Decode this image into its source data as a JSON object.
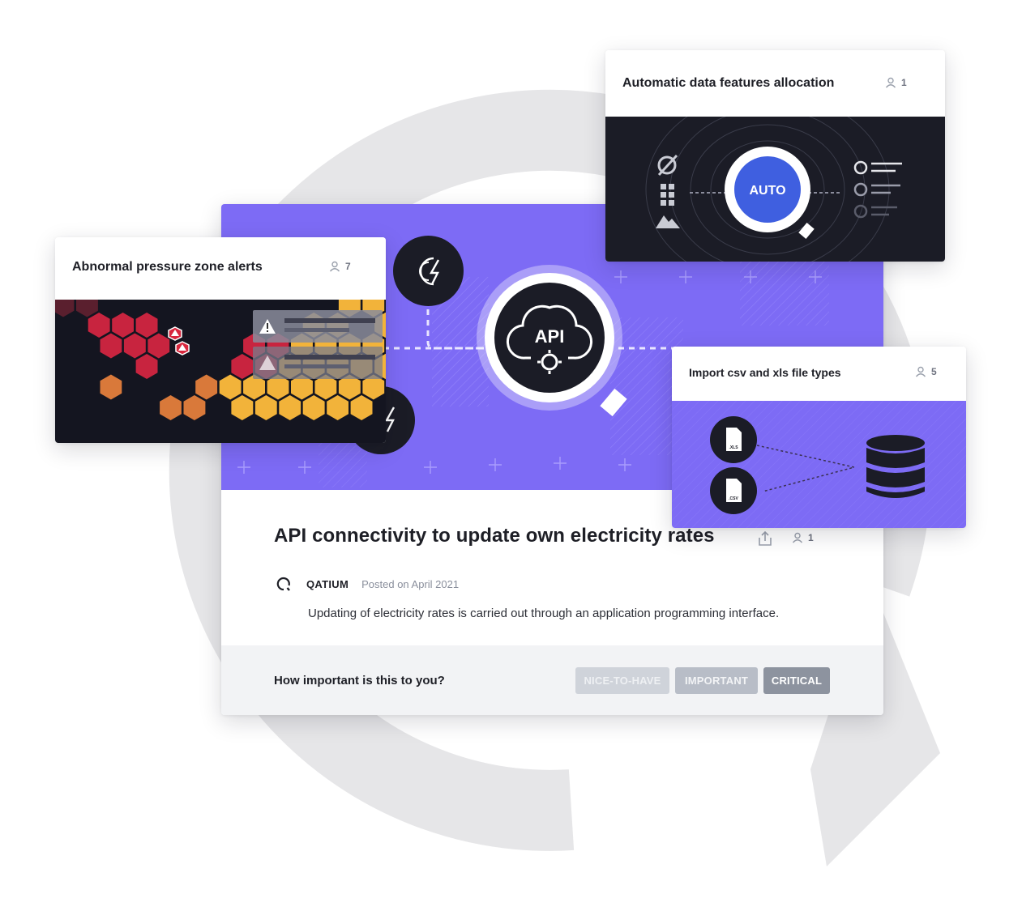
{
  "main_card": {
    "title": "API connectivity to update own electricity rates",
    "votes": "1",
    "author": "QATIUM",
    "posted": "Posted on April 2021",
    "description": "Updating of electricity rates is carried out through an application programming interface.",
    "hero_label": "API",
    "importance_question": "How important is this to you?",
    "importance_options": [
      "NICE-TO-HAVE",
      "IMPORTANT",
      "CRITICAL"
    ],
    "selected_option": "CRITICAL"
  },
  "cards": {
    "alerts": {
      "title": "Abnormal pressure zone alerts",
      "votes": "7"
    },
    "auto": {
      "title": "Automatic data features allocation",
      "votes": "1",
      "badge": "AUTO"
    },
    "import": {
      "title": "Import csv and xls file types",
      "votes": "5",
      "file_labels": [
        ".XLS",
        ".CSV"
      ]
    }
  },
  "icons": [
    "user-icon",
    "share-icon",
    "qatium-logo-icon",
    "api-cloud-icon",
    "energy-icon",
    "warning-icon",
    "file-icon",
    "database-icon",
    "magnifier-icon"
  ],
  "colors": {
    "accent_purple": "#7d6bf5",
    "dark": "#1b1c26",
    "auto_blue": "#3f5fe0",
    "hex_yellow": "#f2b33a",
    "hex_red": "#c8243f",
    "alert_red": "#d7263d",
    "critical_button": "#8d939f"
  }
}
